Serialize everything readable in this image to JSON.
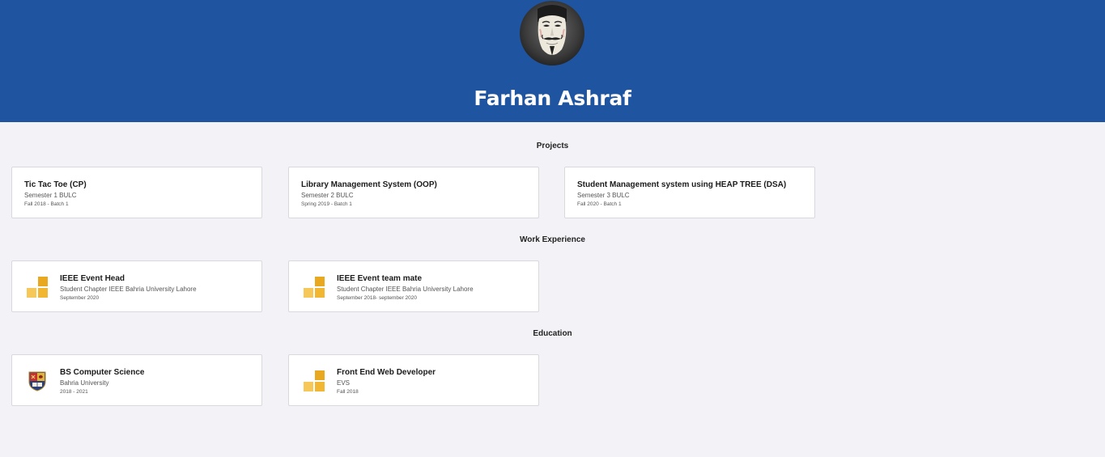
{
  "profile": {
    "name": "Farhan Ashraf",
    "avatar_icon": "guy-fawkes-mask-avatar"
  },
  "colors": {
    "header_bg": "#1f54a0",
    "page_bg": "#f3f3f7",
    "logo_gold": "#e8a820",
    "logo_light": "#f6c85a"
  },
  "sections": {
    "projects": {
      "title": "Projects",
      "items": [
        {
          "title": "Tic Tac Toe (CP)",
          "sub": "Semester 1 BULC",
          "date": "Fall 2018 - Batch 1"
        },
        {
          "title": "Library Management System (OOP)",
          "sub": "Semester 2 BULC",
          "date": "Spring 2019 - Batch 1"
        },
        {
          "title": "Student Management system using HEAP TREE (DSA)",
          "sub": "Semester 3 BULC",
          "date": "Fall 2020 - Batch 1"
        }
      ]
    },
    "work": {
      "title": "Work Experience",
      "items": [
        {
          "title": "IEEE Event Head",
          "sub": "Student Chapter IEEE Bahria University Lahore",
          "date": "September 2020",
          "icon": "company-logo-icon"
        },
        {
          "title": "IEEE Event team mate",
          "sub": "Student Chapter IEEE Bahria University Lahore",
          "date": "September 2018- september 2020",
          "icon": "company-logo-icon"
        }
      ]
    },
    "education": {
      "title": "Education",
      "items": [
        {
          "title": "BS Computer Science",
          "sub": "Bahria University",
          "date": "2018 - 2021",
          "icon": "university-crest-icon"
        },
        {
          "title": "Front End Web Developer",
          "sub": "EVS",
          "date": "Fall 2018",
          "icon": "company-logo-icon"
        }
      ]
    }
  }
}
